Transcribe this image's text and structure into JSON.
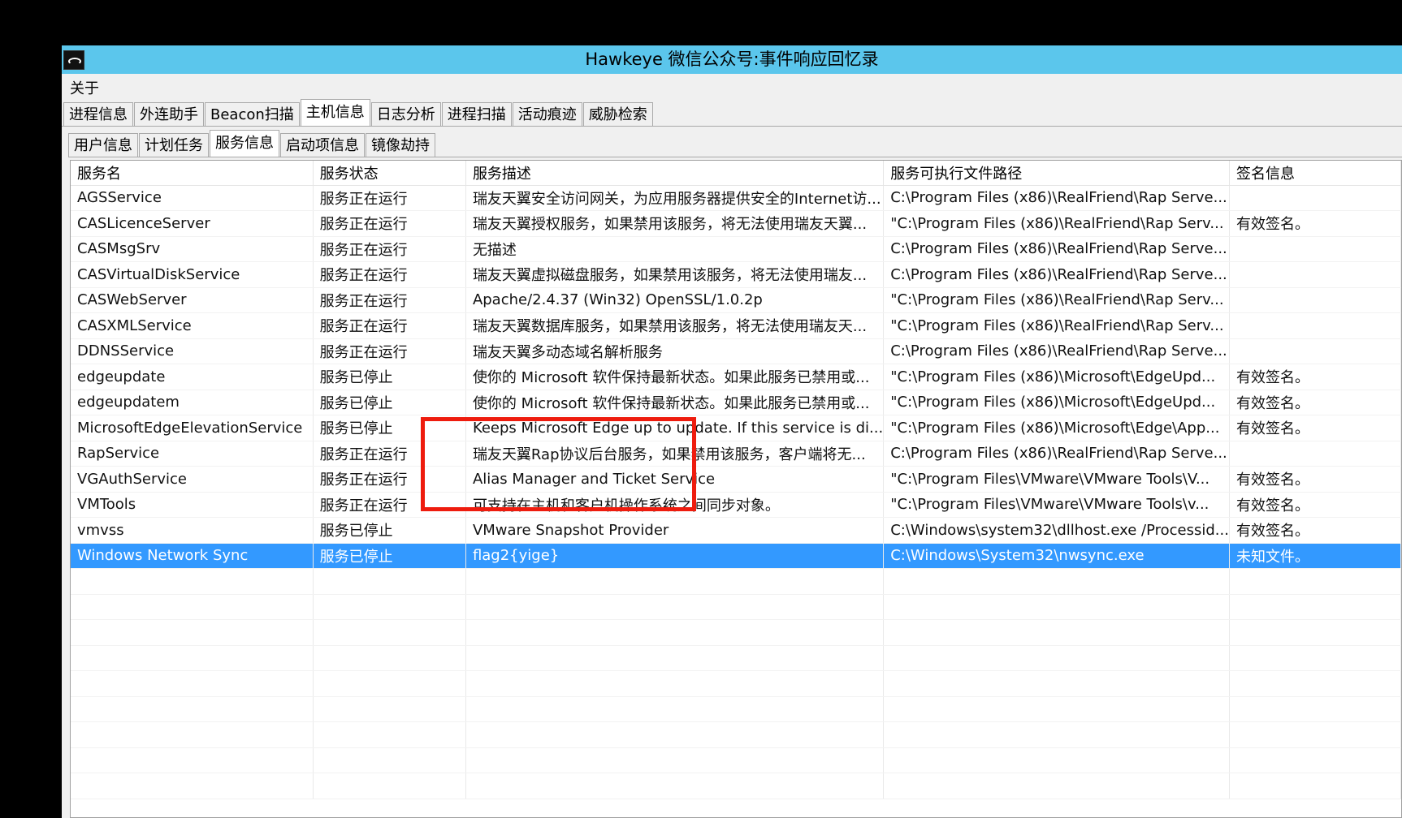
{
  "window": {
    "title": "Hawkeye 微信公众号:事件响应回忆录"
  },
  "menu": {
    "about": "关于"
  },
  "tabs_main": [
    {
      "label": "进程信息",
      "active": false
    },
    {
      "label": "外连助手",
      "active": false
    },
    {
      "label": "Beacon扫描",
      "active": false
    },
    {
      "label": "主机信息",
      "active": true
    },
    {
      "label": "日志分析",
      "active": false
    },
    {
      "label": "进程扫描",
      "active": false
    },
    {
      "label": "活动痕迹",
      "active": false
    },
    {
      "label": "威胁检索",
      "active": false
    }
  ],
  "tabs_sub": [
    {
      "label": "用户信息",
      "active": false
    },
    {
      "label": "计划任务",
      "active": false
    },
    {
      "label": "服务信息",
      "active": true
    },
    {
      "label": "启动项信息",
      "active": false
    },
    {
      "label": "镜像劫持",
      "active": false
    }
  ],
  "table": {
    "headers": [
      "服务名",
      "服务状态",
      "服务描述",
      "服务可执行文件路径",
      "签名信息"
    ],
    "rows": [
      [
        "AGSService",
        "服务正在运行",
        "瑞友天翼安全访问网关，为应用服务器提供安全的Internet访...",
        "C:\\Program Files (x86)\\RealFriend\\Rap Serve...",
        ""
      ],
      [
        "CASLicenceServer",
        "服务正在运行",
        "瑞友天翼授权服务，如果禁用该服务，将无法使用瑞友天翼...",
        "\"C:\\Program Files (x86)\\RealFriend\\Rap Serv...",
        "有效签名。"
      ],
      [
        "CASMsgSrv",
        "服务正在运行",
        "无描述",
        "C:\\Program Files (x86)\\RealFriend\\Rap Serve...",
        ""
      ],
      [
        "CASVirtualDiskService",
        "服务正在运行",
        "瑞友天翼虚拟磁盘服务，如果禁用该服务，将无法使用瑞友...",
        "C:\\Program Files (x86)\\RealFriend\\Rap Serve...",
        ""
      ],
      [
        "CASWebServer",
        "服务正在运行",
        "Apache/2.4.37 (Win32) OpenSSL/1.0.2p",
        "\"C:\\Program Files (x86)\\RealFriend\\Rap Serv...",
        ""
      ],
      [
        "CASXMLService",
        "服务正在运行",
        "瑞友天翼数据库服务，如果禁用该服务，将无法使用瑞友天...",
        "\"C:\\Program Files (x86)\\RealFriend\\Rap Serv...",
        ""
      ],
      [
        "DDNSService",
        "服务正在运行",
        "瑞友天翼多动态域名解析服务",
        "C:\\Program Files (x86)\\RealFriend\\Rap Serve...",
        ""
      ],
      [
        "edgeupdate",
        "服务已停止",
        "使你的 Microsoft 软件保持最新状态。如果此服务已禁用或...",
        "\"C:\\Program Files (x86)\\Microsoft\\EdgeUpd...",
        "有效签名。"
      ],
      [
        "edgeupdatem",
        "服务已停止",
        "使你的 Microsoft 软件保持最新状态。如果此服务已禁用或...",
        "\"C:\\Program Files (x86)\\Microsoft\\EdgeUpd...",
        "有效签名。"
      ],
      [
        "MicrosoftEdgeElevationService",
        "服务已停止",
        "Keeps Microsoft Edge up to update. If this service is di...",
        "\"C:\\Program Files (x86)\\Microsoft\\Edge\\App...",
        "有效签名。"
      ],
      [
        "RapService",
        "服务正在运行",
        "瑞友天翼Rap协议后台服务，如果禁用该服务，客户端将无...",
        "C:\\Program Files (x86)\\RealFriend\\Rap Serve...",
        ""
      ],
      [
        "VGAuthService",
        "服务正在运行",
        "Alias Manager and Ticket Service",
        "\"C:\\Program Files\\VMware\\VMware Tools\\V...",
        "有效签名。"
      ],
      [
        "VMTools",
        "服务正在运行",
        "可支持在主机和客户机操作系统之间同步对象。",
        "\"C:\\Program Files\\VMware\\VMware Tools\\v...",
        "有效签名。"
      ],
      [
        "vmvss",
        "服务已停止",
        "VMware Snapshot Provider",
        "C:\\Windows\\system32\\dllhost.exe /Processid...",
        "有效签名。"
      ],
      [
        "Windows Network Sync",
        "服务已停止",
        "flag2{yige}",
        "C:\\Windows\\System32\\nwsync.exe",
        "未知文件。"
      ]
    ],
    "selected_row": 14
  },
  "colors": {
    "titlebar": "#5bc6ec",
    "selection": "#3399ff",
    "highlight": "#ee1c0e"
  }
}
